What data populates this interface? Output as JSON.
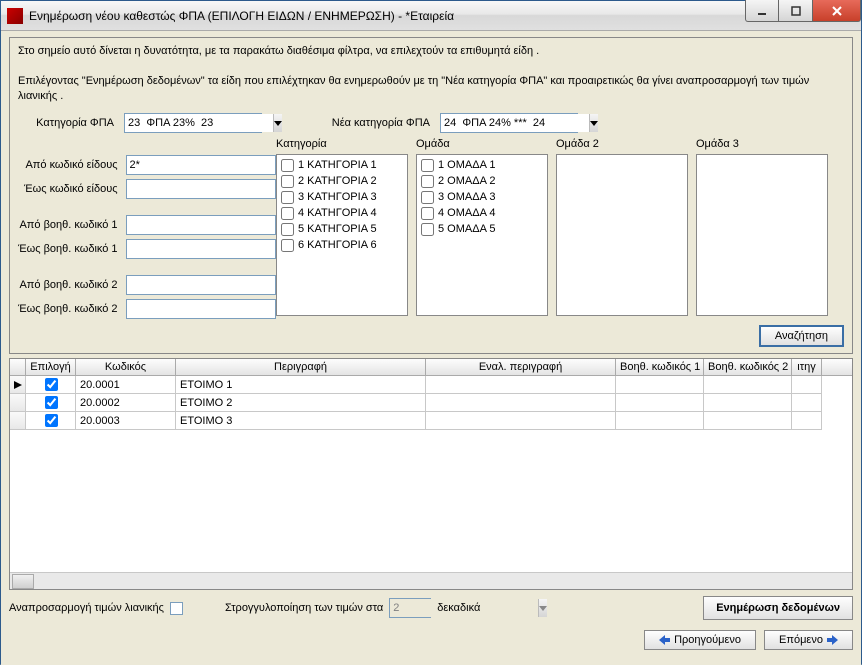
{
  "window": {
    "title": "Ενημέρωση νέου καθεστώς ΦΠΑ (ΕΠΙΛΟΓΗ ΕΙΔΩΝ / ΕΝΗΜΕΡΩΣΗ) - *Εταιρεία"
  },
  "intro": {
    "line1": "Στο σημείο αυτό  δίνεται η δυνατότητα, με τα παρακάτω διαθέσιμα φίλτρα, να επιλεχτούν τα επιθυμητά είδη .",
    "line2": "Επιλέγοντας \"Ενημέρωση δεδομένων\" τα είδη που επιλέχτηκαν θα ενημερωθούν με τη \"Νέα κατηγορία ΦΠΑ\" και προαιρετικώς θα γίνει αναπροσαρμογή των τιμών λιανικής ."
  },
  "labels": {
    "vat_cat": "Κατηγορία ΦΠΑ",
    "new_vat_cat": "Νέα κατηγορία ΦΠΑ",
    "from_code": "Από κωδικό είδους",
    "to_code": "Έως κωδικό είδους",
    "from_b1": "Από βοηθ. κωδικό 1",
    "to_b1": "Έως βοηθ. κωδικό 1",
    "from_b2": "Από βοηθ. κωδικό 2",
    "to_b2": "Έως βοηθ. κωδικό 2",
    "cat_head": "Κατηγορία",
    "group_head": "Ομάδα",
    "group2_head": "Ομάδα 2",
    "group3_head": "Ομάδα 3"
  },
  "inputs": {
    "vat_cat_value": "23  ΦΠΑ 23%  23",
    "new_vat_cat_value": "24  ΦΠΑ 24% ***  24",
    "from_code_value": "2*",
    "to_code_value": "",
    "from_b1_value": "",
    "to_b1_value": "",
    "from_b2_value": "",
    "to_b2_value": ""
  },
  "categories": [
    "1  ΚΑΤΗΓΟΡΙΑ 1",
    "2  ΚΑΤΗΓΟΡΙΑ 2",
    "3  ΚΑΤΗΓΟΡΙΑ 3",
    "4  ΚΑΤΗΓΟΡΙΑ 4",
    "5  ΚΑΤΗΓΟΡΙΑ 5",
    "6  ΚΑΤΗΓΟΡΙΑ 6"
  ],
  "groups": [
    "1  ΟΜΑΔΑ 1",
    "2  ΟΜΑΔΑ 2",
    "3  ΟΜΑΔΑ 3",
    "4  ΟΜΑΔΑ 4",
    "5  ΟΜΑΔΑ 5"
  ],
  "buttons": {
    "search": "Αναζήτηση",
    "prev": "Προηγούμενο",
    "next": "Επόμενο",
    "update": "Ενημέρωση δεδομένων"
  },
  "grid": {
    "headers": {
      "sel": "Επιλογή",
      "code": "Κωδικός",
      "desc": "Περιγραφή",
      "alt": "Εναλ. περιγραφή",
      "b1": "Βοηθ. κωδικός 1",
      "b2": "Βοηθ. κωδικός 2",
      "last": "ιτηγ"
    },
    "rows": [
      {
        "selected": true,
        "code": "20.0001",
        "desc": "ETOIMO 1",
        "alt": "",
        "b1": "",
        "b2": ""
      },
      {
        "selected": true,
        "code": "20.0002",
        "desc": "ETOIMO 2",
        "alt": "",
        "b1": "",
        "b2": ""
      },
      {
        "selected": true,
        "code": "20.0003",
        "desc": "ETOIMO 3",
        "alt": "",
        "b1": "",
        "b2": ""
      }
    ]
  },
  "footer": {
    "reprice_label": "Αναπροσαρμογή τιμών λιανικής",
    "round_label_pre": "Στρογγυλοποίηση των τιμών στα",
    "round_value": "2",
    "round_label_post": "δεκαδικά"
  }
}
